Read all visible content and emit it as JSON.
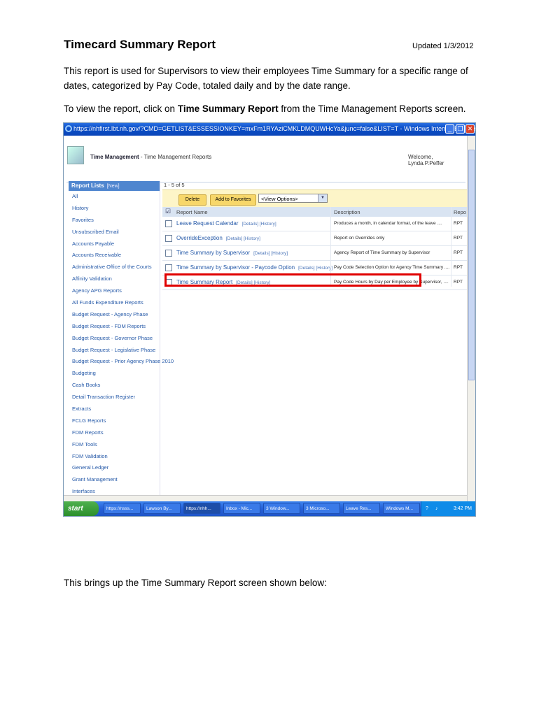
{
  "doc": {
    "title": "Timecard Summary Report",
    "updated": "Updated 1/3/2012",
    "intro": "This report is used for Supervisors to view their employees Time Summary for a specific range of dates, categorized by Pay Code, totaled daily and by the date range.",
    "instruction_before": "To view the report, click on ",
    "instruction_bold": "Time Summary Report",
    "instruction_after": " from the Time Management Reports screen.",
    "closing": "This brings up the Time Summary Report screen shown below:"
  },
  "browser": {
    "title_bar": "https://nhfirst.lbt.nh.gov/?CMD=GETLIST&ESSESSIONKEY=mxFm1RYAziCMKLDMQUWHcYa&junc=false&LIST=T - Windows Internet Explorer",
    "icons": [
      "ie-icon",
      "minimize-icon",
      "restore-icon",
      "close-icon"
    ]
  },
  "app": {
    "title_bold": "Time Management",
    "title_rest": " - Time Management Reports",
    "welcome": "Welcome, Lynda.P.Peffer"
  },
  "sidebar": {
    "header": "Report Lists",
    "new_label": "[New]",
    "items": [
      "All",
      "History",
      "Favorites",
      "Unsubscribed Email",
      "Accounts Payable",
      "Accounts Receivable",
      "Administrative Office of the Courts",
      "Affinity Validation",
      "Agency APG Reports",
      "All Funds Expenditure Reports",
      "Budget Request - Agency Phase",
      "Budget Request - FDM Reports",
      "Budget Request - Governor Phase",
      "Budget Request - Legislative Phase",
      "Budget Request - Prior Agency Phase 2010",
      "Budgeting",
      "Cash Books",
      "Detail Transaction Register",
      "Extracts",
      "FCLG Reports",
      "FDM Reports",
      "FDM Tools",
      "FDM Validation",
      "General Ledger",
      "Grant Management",
      "Interfaces"
    ]
  },
  "list": {
    "pager": "1 - 5 of 5",
    "delete_label": "Delete",
    "favorites_label": "Add to Favorites",
    "view_options": "<View Options>",
    "col_name": "Report Name",
    "col_desc": "Description",
    "col_type": "Repo",
    "details_label": "[Details]",
    "history_label": "[History]",
    "rows": [
      {
        "name": "Leave Request Calendar",
        "desc": "Produces a month, in calendar format, of the leave ....",
        "type": "RPT"
      },
      {
        "name": "OverrideException",
        "desc": "Report on Overrides only",
        "type": "RPT"
      },
      {
        "name": "Time Summary by Supervisor",
        "desc": "Agency Report of Time Summary by Supervisor",
        "type": "RPT"
      },
      {
        "name": "Time Summary by Supervisor - Paycode Option",
        "desc": "Pay Code Selection Option for Agency Time Summary ....",
        "type": "RPT"
      },
      {
        "name": "Time Summary Report",
        "desc": "Pay Code Hours by Day per Employee by Supervisor, ....",
        "type": "RPT"
      }
    ]
  },
  "taskbar": {
    "start": "start",
    "tasks": [
      "https://nsss...",
      "Lawson By...",
      "https://nhh...",
      "Inbox - Mic...",
      "3 Window...",
      "3 Microso...",
      "Leave Res...",
      "Windows M..."
    ],
    "clock": "3:42 PM"
  },
  "colors": {
    "highlight": "#e00000",
    "link": "#2559a8",
    "sidebar_header": "#4f86cf",
    "toolbar": "#fdf5c8"
  }
}
